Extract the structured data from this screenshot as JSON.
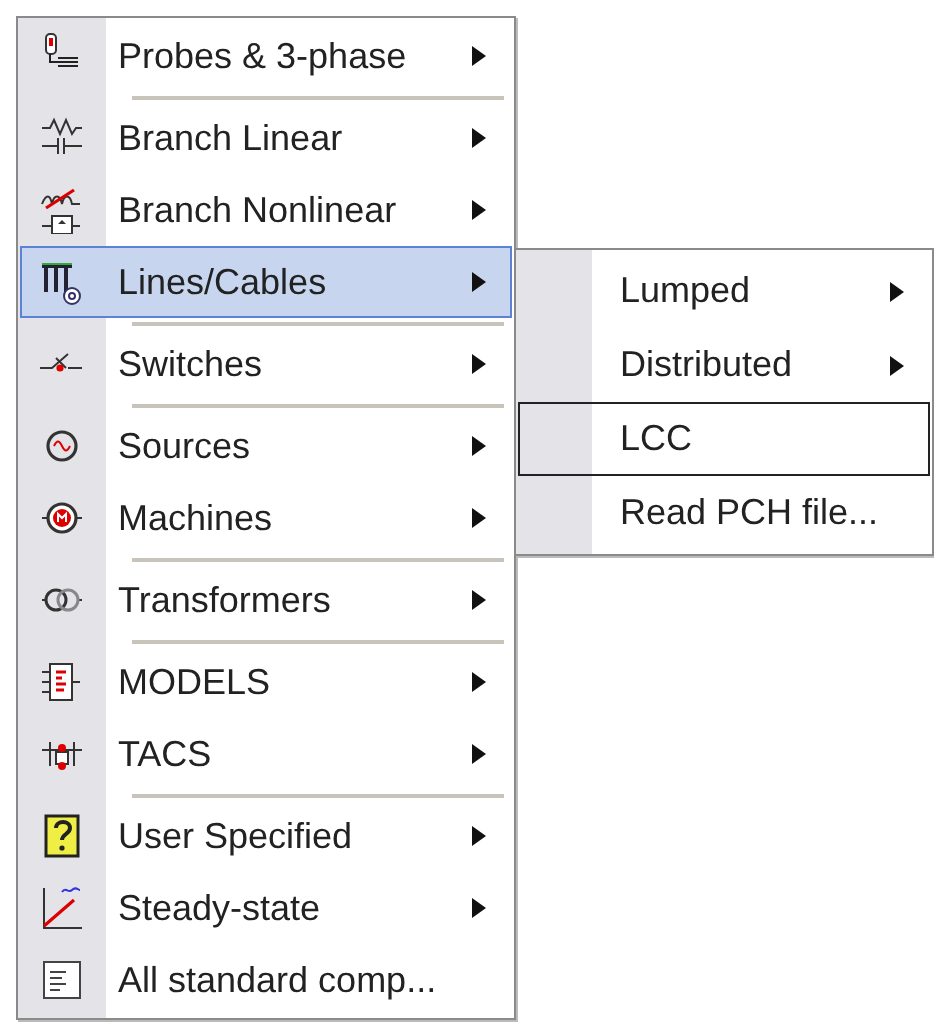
{
  "menu": {
    "items": [
      {
        "kind": "item",
        "label": "Probes & 3-phase",
        "submenu": true,
        "selected": false
      },
      {
        "kind": "separator"
      },
      {
        "kind": "item",
        "label": "Branch Linear",
        "submenu": true,
        "selected": false
      },
      {
        "kind": "item",
        "label": "Branch Nonlinear",
        "submenu": true,
        "selected": false
      },
      {
        "kind": "item",
        "label": "Lines/Cables",
        "submenu": true,
        "selected": true
      },
      {
        "kind": "separator"
      },
      {
        "kind": "item",
        "label": "Switches",
        "submenu": true,
        "selected": false
      },
      {
        "kind": "separator"
      },
      {
        "kind": "item",
        "label": "Sources",
        "submenu": true,
        "selected": false
      },
      {
        "kind": "item",
        "label": "Machines",
        "submenu": true,
        "selected": false
      },
      {
        "kind": "separator"
      },
      {
        "kind": "item",
        "label": "Transformers",
        "submenu": true,
        "selected": false
      },
      {
        "kind": "separator"
      },
      {
        "kind": "item",
        "label": "MODELS",
        "submenu": true,
        "selected": false
      },
      {
        "kind": "item",
        "label": "TACS",
        "submenu": true,
        "selected": false
      },
      {
        "kind": "separator"
      },
      {
        "kind": "item",
        "label": "User Specified",
        "submenu": true,
        "selected": false
      },
      {
        "kind": "item",
        "label": "Steady-state",
        "submenu": true,
        "selected": false
      },
      {
        "kind": "item",
        "label": "All standard comp...",
        "submenu": false,
        "selected": false
      }
    ]
  },
  "submenu": {
    "items": [
      {
        "label": "Lumped",
        "submenu": true,
        "selected": false
      },
      {
        "label": "Distributed",
        "submenu": true,
        "selected": false
      },
      {
        "label": "LCC",
        "submenu": false,
        "selected": true
      },
      {
        "label": "Read PCH file...",
        "submenu": false,
        "selected": false
      }
    ]
  }
}
